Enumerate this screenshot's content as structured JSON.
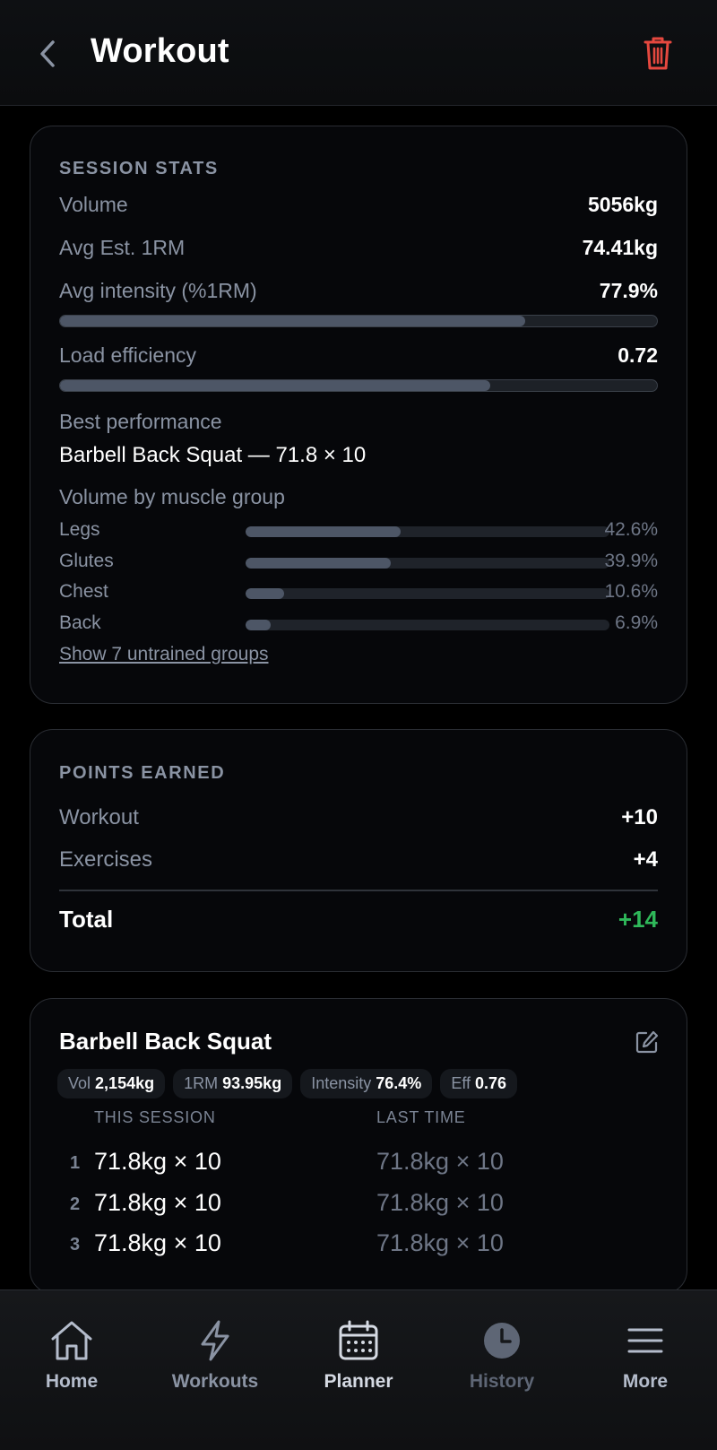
{
  "header": {
    "title": "Workout",
    "back_icon": "chevron-left-icon",
    "delete_icon": "trash-icon",
    "delete_color": "#e5483f"
  },
  "session_stats": {
    "title": "SESSION STATS",
    "volume": {
      "label": "Volume",
      "value": "5056kg"
    },
    "avg_1rm": {
      "label": "Avg Est. 1RM",
      "value": "74.41kg"
    },
    "avg_intensity": {
      "label": "Avg intensity (%1RM)",
      "value": "77.9%",
      "fill_percent": 77.9
    },
    "load_efficiency": {
      "label": "Load efficiency",
      "value": "0.72",
      "fill_percent": 72
    },
    "best_performance": {
      "label": "Best performance",
      "value": "Barbell Back Squat — 71.8 × 10"
    },
    "muscle_groups": {
      "label": "Volume by muscle group",
      "items": [
        {
          "name": "Legs",
          "pct": "42.6%",
          "fill_percent": 42.6
        },
        {
          "name": "Glutes",
          "pct": "39.9%",
          "fill_percent": 39.9
        },
        {
          "name": "Chest",
          "pct": "10.6%",
          "fill_percent": 10.6
        },
        {
          "name": "Back",
          "pct": "6.9%",
          "fill_percent": 6.9
        }
      ],
      "show_more": "Show 7 untrained groups"
    }
  },
  "points": {
    "title": "POINTS EARNED",
    "workout": {
      "label": "Workout",
      "value": "+10"
    },
    "exercises": {
      "label": "Exercises",
      "value": "+4"
    },
    "total": {
      "label": "Total",
      "value": "+14"
    },
    "total_color": "#2fb85a"
  },
  "exercise": {
    "name": "Barbell Back Squat",
    "edit_icon": "edit-icon",
    "chips": [
      {
        "label": "Vol",
        "value": "2,154kg"
      },
      {
        "label": "1RM",
        "value": "93.95kg"
      },
      {
        "label": "Intensity",
        "value": "76.4%"
      },
      {
        "label": "Eff",
        "value": "0.76"
      }
    ],
    "col_this": "THIS SESSION",
    "col_last": "LAST TIME",
    "sets": [
      {
        "idx": "1",
        "current": "71.8kg × 10",
        "last": "71.8kg × 10"
      },
      {
        "idx": "2",
        "current": "71.8kg × 10",
        "last": "71.8kg × 10"
      },
      {
        "idx": "3",
        "current": "71.8kg × 10",
        "last": "71.8kg × 10"
      }
    ]
  },
  "nav": {
    "items": [
      {
        "label": "Home",
        "icon": "home-icon",
        "color": "#b4bccb"
      },
      {
        "label": "Workouts",
        "icon": "lightning-icon",
        "color": "#8a93a3"
      },
      {
        "label": "Planner",
        "icon": "calendar-icon",
        "color": "#d5dae3"
      },
      {
        "label": "History",
        "icon": "clock-icon",
        "color": "#5e6675"
      },
      {
        "label": "More",
        "icon": "menu-icon",
        "color": "#b4bccb"
      }
    ]
  }
}
